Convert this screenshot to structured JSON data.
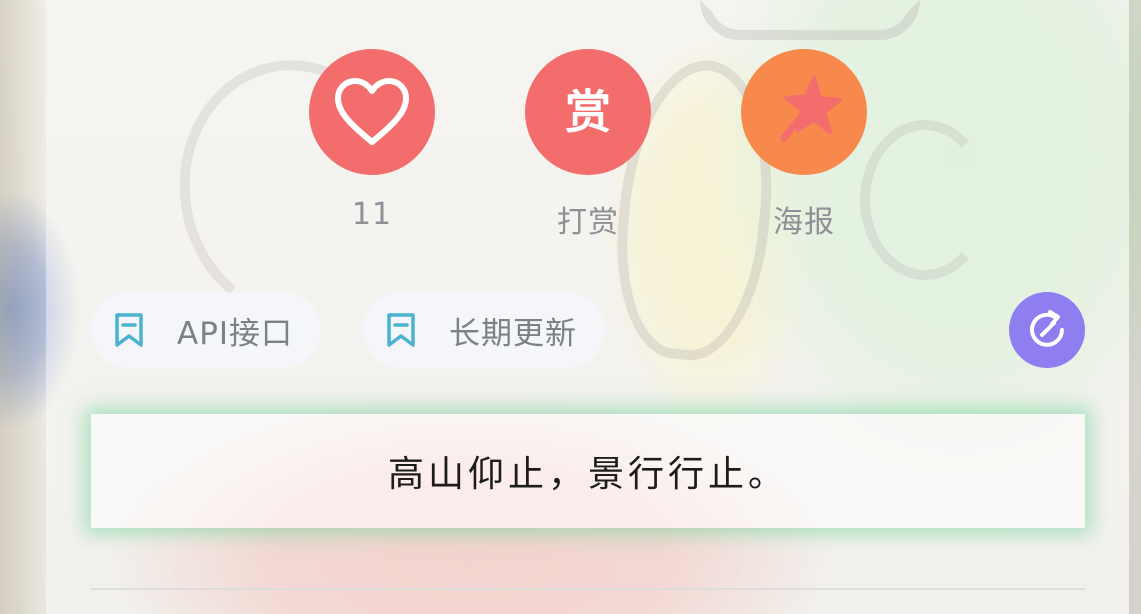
{
  "actions": {
    "like": {
      "count": "11",
      "icon": "heart-icon",
      "color": "#f46d6d"
    },
    "reward": {
      "glyph": "赏",
      "label": "打赏",
      "color": "#f46d6d"
    },
    "poster": {
      "label": "海报",
      "icon": "magic-wand-star-icon",
      "color": "#f7894d"
    }
  },
  "tags": [
    {
      "label": "API接口",
      "icon": "bookmark-icon"
    },
    {
      "label": "长期更新",
      "icon": "bookmark-icon"
    }
  ],
  "share": {
    "icon": "share-rotate-icon",
    "color": "#8e7ef0"
  },
  "quote": {
    "text": "高山仰止，景行行止。"
  }
}
